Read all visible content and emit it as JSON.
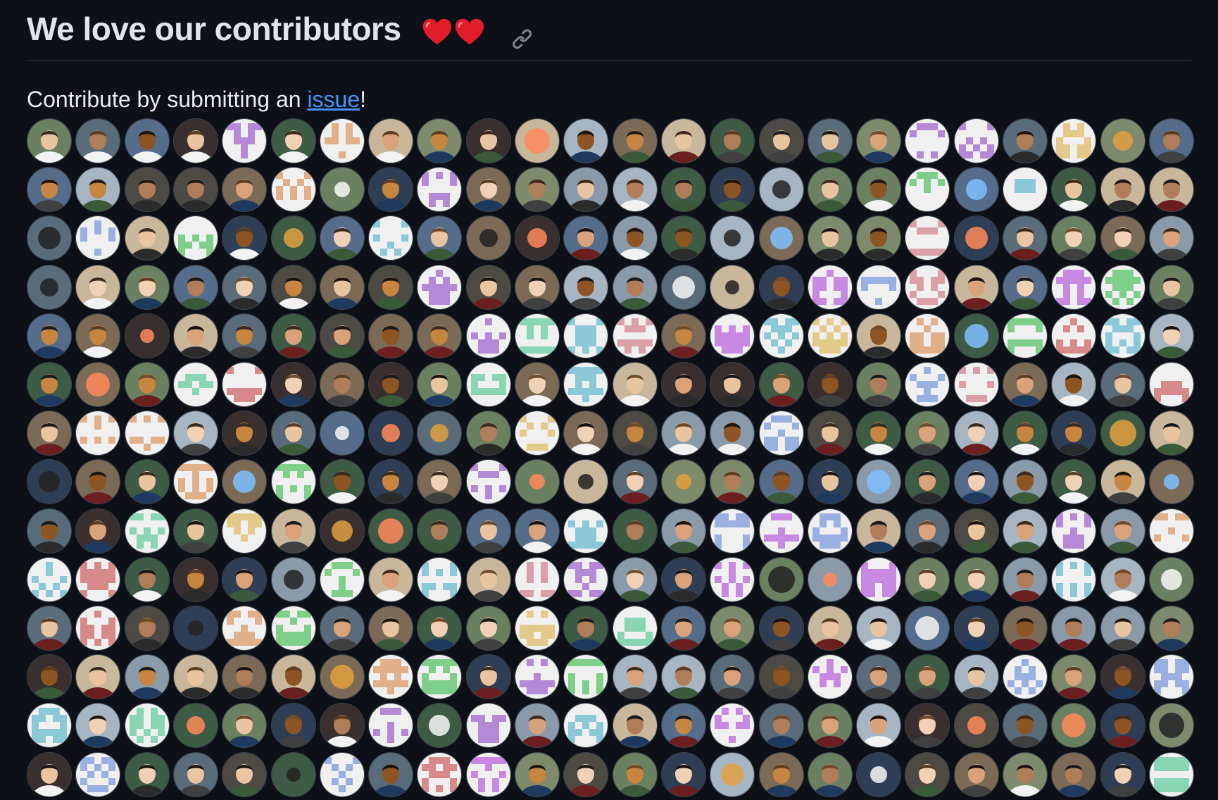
{
  "heading": {
    "title": "We love our contributors",
    "emoji": "❤️❤️",
    "anchor_icon": "link-icon"
  },
  "paragraph": {
    "prefix": "Contribute by submitting an ",
    "link_text": "issue",
    "suffix": "!"
  },
  "contributors": {
    "rows": 14,
    "columns": 24,
    "total_visible": 336,
    "avatar_icon": "avatar-image"
  },
  "colors": {
    "background": "#0d1117",
    "text": "#e6edf3",
    "link": "#4493f8",
    "divider": "#30363d",
    "heart": "#e11d2b"
  }
}
